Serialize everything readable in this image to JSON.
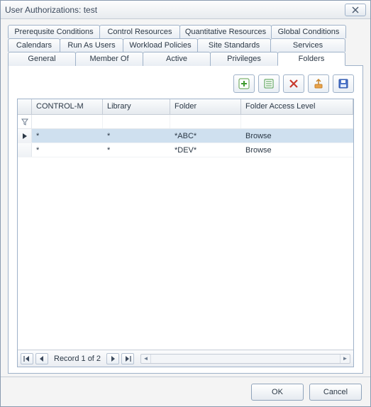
{
  "title": "User Authorizations: test",
  "tabs_row1": [
    "Prerequsite Conditions",
    "Control Resources",
    "Quantitative Resources",
    "Global Conditions"
  ],
  "tabs_row2": [
    "Calendars",
    "Run As Users",
    "Workload Policies",
    "Site Standards",
    "Services"
  ],
  "tabs_row3": [
    "General",
    "Member Of",
    "Active",
    "Privileges",
    "Folders"
  ],
  "active_tab": "Folders",
  "toolbar_icons": [
    "add-icon",
    "properties-icon",
    "delete-icon",
    "export-icon",
    "save-icon"
  ],
  "grid": {
    "columns": [
      "CONTROL-M",
      "Library",
      "Folder",
      "Folder Access Level"
    ],
    "rows": [
      {
        "control": "*",
        "library": "*",
        "folder": "*ABC*",
        "access": "Browse",
        "selected": true
      },
      {
        "control": "*",
        "library": "*",
        "folder": "*DEV*",
        "access": "Browse",
        "selected": false
      }
    ]
  },
  "record_text": "Record 1 of 2",
  "buttons": {
    "ok": "OK",
    "cancel": "Cancel"
  }
}
